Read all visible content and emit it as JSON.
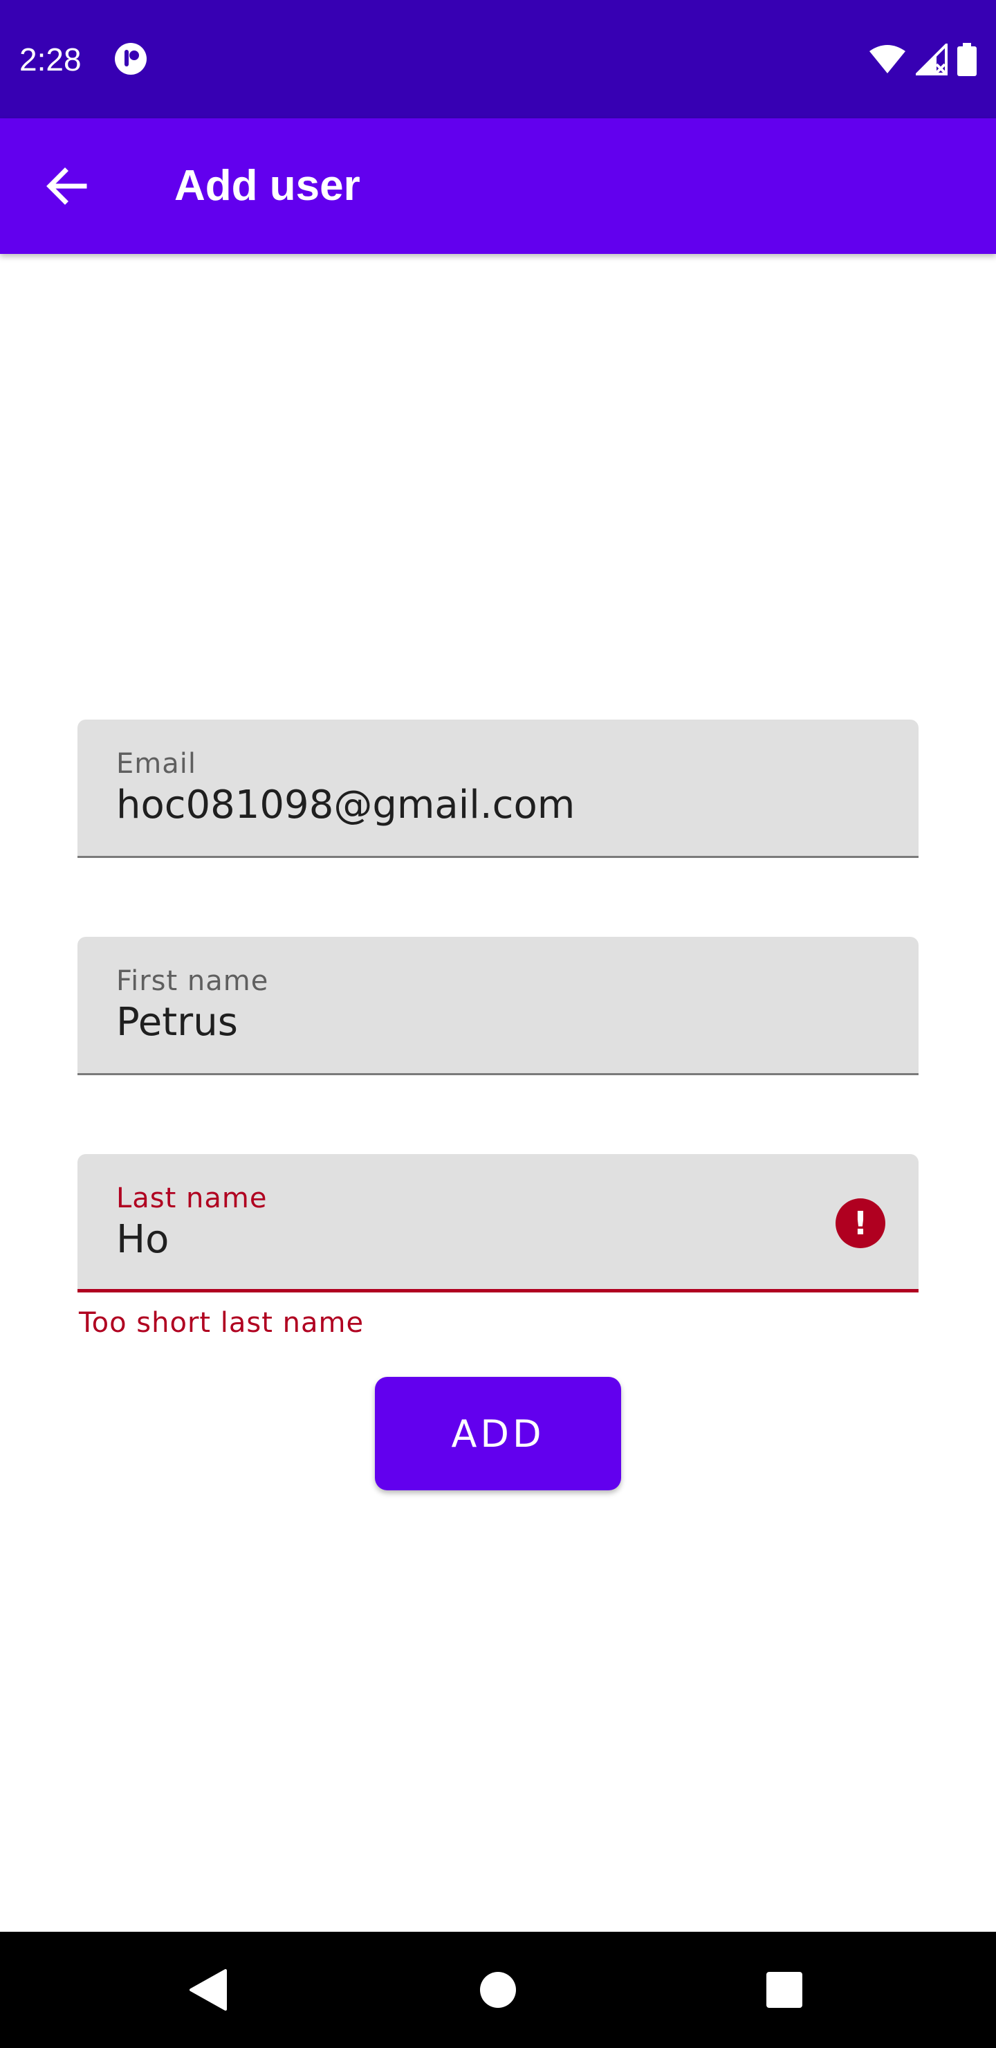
{
  "status_bar": {
    "time": "2:28",
    "icons": [
      "app-notification-icon",
      "wifi-icon",
      "signal-icon",
      "battery-icon"
    ]
  },
  "app_bar": {
    "title": "Add user",
    "back_icon": "arrow-back-icon"
  },
  "form": {
    "email": {
      "label": "Email",
      "value": "hoc081098@gmail.com"
    },
    "first_name": {
      "label": "First name",
      "value": "Petrus"
    },
    "last_name": {
      "label": "Last name",
      "value": "Ho",
      "error": "Too short last name",
      "error_icon": "!"
    },
    "submit_label": "ADD"
  },
  "nav_bar": {
    "icons": [
      "back-triangle-icon",
      "home-circle-icon",
      "recents-square-icon"
    ]
  },
  "colors": {
    "status_bar": "#3700b3",
    "primary": "#6200ee",
    "error": "#b00020",
    "field_bg": "#e0e0e0"
  }
}
